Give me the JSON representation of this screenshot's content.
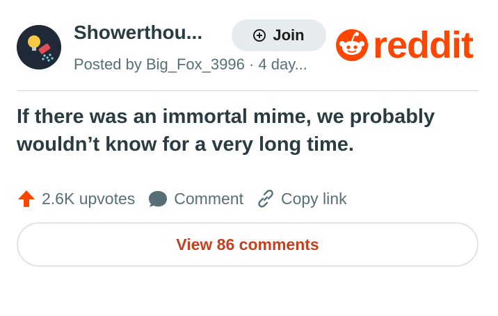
{
  "header": {
    "community_name": "Showerthou...",
    "join_label": "Join",
    "posted_by": "Posted by Big_Fox_3996 · 4 day..."
  },
  "brand": {
    "wordmark": "reddit",
    "color": "#ff4500"
  },
  "post": {
    "title": "If there was an immortal mime, we probably wouldn’t know for a very long time."
  },
  "actions": {
    "upvotes": "2.6K upvotes",
    "comment": "Comment",
    "copy_link": "Copy link"
  },
  "footer": {
    "view_comments": "View 86 comments"
  },
  "icons": [
    "shower-head-avatar-icon",
    "plus-circle-icon",
    "reddit-snoo-icon",
    "upvote-arrow-icon",
    "comment-bubble-icon",
    "link-icon"
  ],
  "colors": {
    "upvote": "#ff4500",
    "view_comments_text": "#c4401f",
    "join_bg": "#e6ebee"
  }
}
